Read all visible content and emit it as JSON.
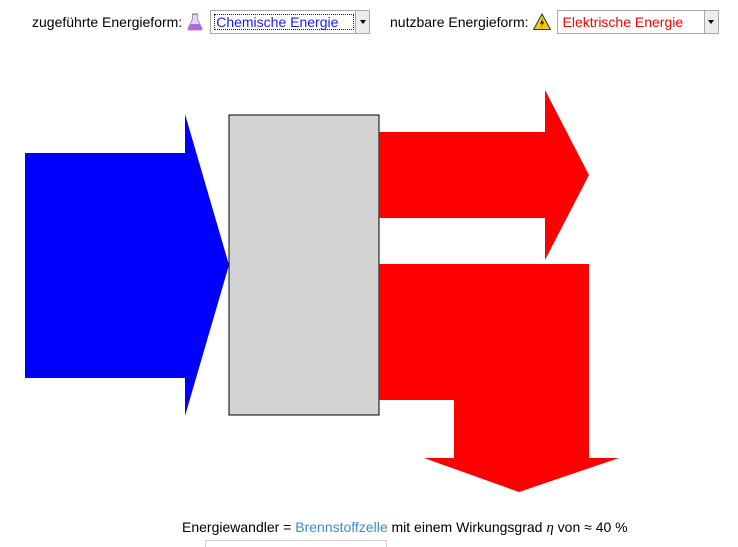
{
  "input_control": {
    "label": "zugeführte Energieform:",
    "icon": "flask-icon",
    "selected": "Chemische Energie",
    "color": "#1a1aff"
  },
  "output_control": {
    "label": "nutzbare Energieform:",
    "icon": "warning-icon",
    "selected": "Elektrische Energie",
    "color": "#ff0000"
  },
  "diagram": {
    "input_arrow_color": "#0000ff",
    "converter_color": "#d3d3d3",
    "useful_arrow_color": "#ff0000",
    "loss_arrow_color": "#ff0000"
  },
  "caption": {
    "prefix": "Energiewandler = ",
    "device": "Brennstoffzelle",
    "middle": " mit einem Wirkungsgrad ",
    "symbol": "η",
    "suffix": " von ≈ 40 %"
  }
}
